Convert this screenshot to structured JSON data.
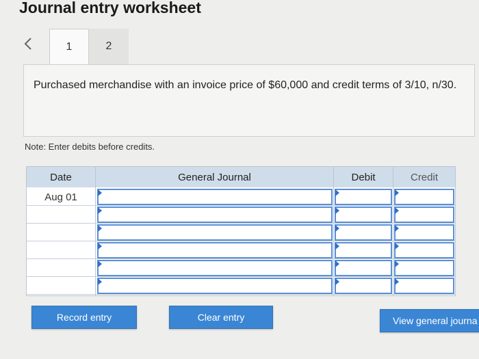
{
  "header": {
    "title": "Journal entry worksheet"
  },
  "nav": {
    "prev_icon": "chevron-left-icon"
  },
  "tabs": [
    {
      "label": "1",
      "active": true
    },
    {
      "label": "2",
      "active": false
    }
  ],
  "question": {
    "text": "Purchased merchandise with an invoice price of $60,000 and credit terms of 3/10, n/30."
  },
  "note": "Note: Enter debits before credits.",
  "journal": {
    "columns": {
      "date": "Date",
      "general_journal": "General Journal",
      "debit": "Debit",
      "credit": "Credit"
    },
    "rows": [
      {
        "date": "Aug 01",
        "account": "",
        "debit": "",
        "credit": ""
      },
      {
        "date": "",
        "account": "",
        "debit": "",
        "credit": ""
      },
      {
        "date": "",
        "account": "",
        "debit": "",
        "credit": ""
      },
      {
        "date": "",
        "account": "",
        "debit": "",
        "credit": ""
      },
      {
        "date": "",
        "account": "",
        "debit": "",
        "credit": ""
      },
      {
        "date": "",
        "account": "",
        "debit": "",
        "credit": ""
      }
    ]
  },
  "buttons": {
    "record": "Record entry",
    "clear": "Clear entry",
    "view": "View general journa"
  },
  "colors": {
    "header_bg": "#cfdcea",
    "button_bg": "#3a86d4",
    "input_border": "#5b8fd6"
  }
}
